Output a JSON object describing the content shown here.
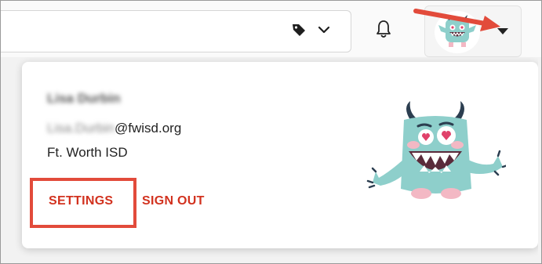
{
  "header": {
    "tag_icon": "tag-icon",
    "chevron_icon": "chevron-down-icon",
    "bell_icon": "bell-icon",
    "avatar_caret_icon": "caret-down-icon"
  },
  "profile_menu": {
    "name": "Lisa Durbin",
    "email_user": "Lisa.Durbin",
    "email_domain": "@fwisd.org",
    "organization": "Ft. Worth ISD",
    "settings_label": "SETTINGS",
    "sign_out_label": "SIGN OUT"
  },
  "colors": {
    "action_red": "#d2321f",
    "highlight_red": "#e24b3b",
    "monster_teal": "#8ecfcb"
  }
}
